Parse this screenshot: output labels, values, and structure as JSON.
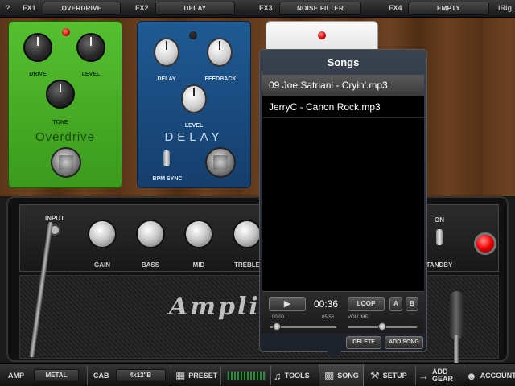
{
  "fxbar": {
    "help": "?",
    "slots": [
      {
        "label": "FX1",
        "value": "OVERDRIVE"
      },
      {
        "label": "FX2",
        "value": "DELAY"
      },
      {
        "label": "FX3",
        "value": "NOISE FILTER"
      },
      {
        "label": "FX4",
        "value": "EMPTY"
      }
    ],
    "brand": "iRig"
  },
  "pedals": {
    "overdrive": {
      "name": "Overdrive",
      "knobs": [
        "DRIVE",
        "LEVEL",
        "TONE"
      ]
    },
    "delay": {
      "name": "DELAY",
      "knobs": [
        "DELAY",
        "FEEDBACK",
        "LEVEL"
      ],
      "switch_label": "BPM SYNC"
    }
  },
  "amp": {
    "logo": "Ampli",
    "knobs": [
      "INPUT",
      "GAIN",
      "BASS",
      "MID",
      "TREBLE"
    ],
    "power_label": "ON",
    "standby_label": "TANDBY"
  },
  "songs": {
    "title": "Songs",
    "items": [
      "09 Joe Satriani - Cryin'.mp3",
      "JerryC - Canon Rock.mp3"
    ],
    "selected_index": 0,
    "time": "00:36",
    "position_start": "00:00",
    "position_end": "05:56",
    "position_fraction": 0.1,
    "volume_label": "VOLUME",
    "volume_fraction": 0.5,
    "loop_label": "LOOP",
    "a_label": "A",
    "b_label": "B",
    "delete_label": "DELETE",
    "add_label": "ADD SONG"
  },
  "bottom": {
    "amp_label": "AMP",
    "amp_value": "METAL",
    "cab_label": "CAB",
    "cab_value": "4x12\"B",
    "preset_label": "PRESET",
    "tools_label": "TOOLS",
    "song_label": "SONG",
    "setup_label": "SETUP",
    "add_gear_label": "ADD GEAR",
    "account_label": "ACCOUNT"
  }
}
